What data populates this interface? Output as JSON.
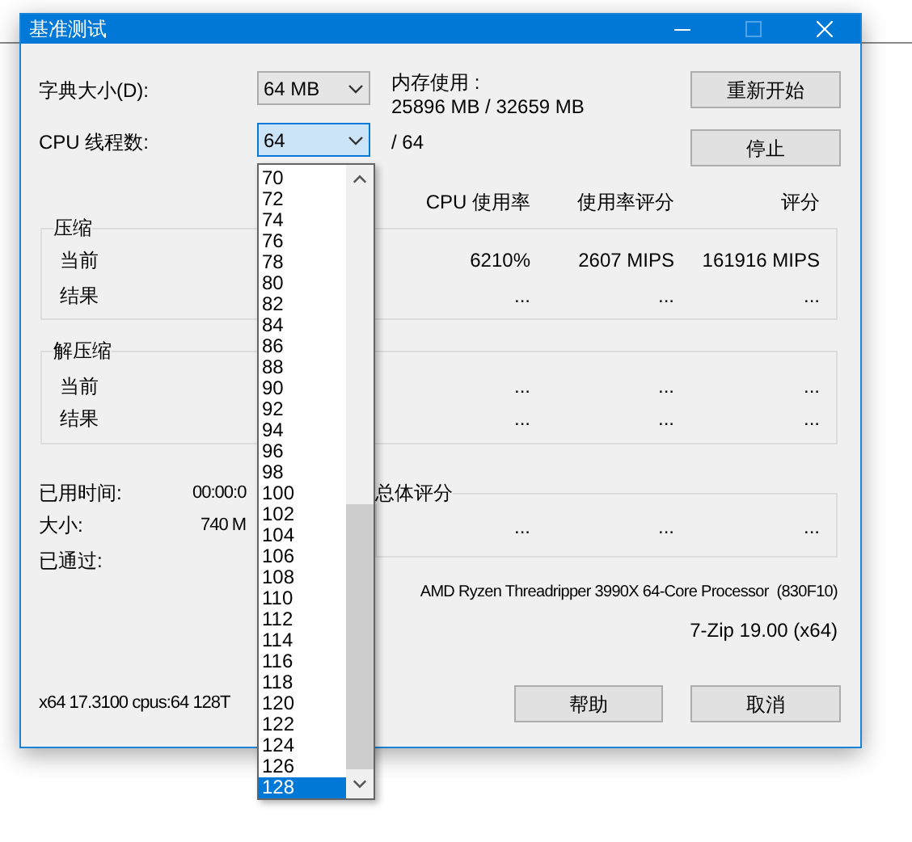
{
  "window": {
    "title": "基准测试"
  },
  "dictionary": {
    "label": "字典大小(D):",
    "value": "64 MB"
  },
  "memory": {
    "label": "内存使用 :",
    "value": "25896 MB / 32659 MB"
  },
  "threads": {
    "label": "CPU 线程数:",
    "value": "64",
    "max": "/ 64",
    "options": [
      {
        "label": "70",
        "selected": false
      },
      {
        "label": "72",
        "selected": false
      },
      {
        "label": "74",
        "selected": false
      },
      {
        "label": "76",
        "selected": false
      },
      {
        "label": "78",
        "selected": false
      },
      {
        "label": "80",
        "selected": false
      },
      {
        "label": "82",
        "selected": false
      },
      {
        "label": "84",
        "selected": false
      },
      {
        "label": "86",
        "selected": false
      },
      {
        "label": "88",
        "selected": false
      },
      {
        "label": "90",
        "selected": false
      },
      {
        "label": "92",
        "selected": false
      },
      {
        "label": "94",
        "selected": false
      },
      {
        "label": "96",
        "selected": false
      },
      {
        "label": "98",
        "selected": false
      },
      {
        "label": "100",
        "selected": false
      },
      {
        "label": "102",
        "selected": false
      },
      {
        "label": "104",
        "selected": false
      },
      {
        "label": "106",
        "selected": false
      },
      {
        "label": "108",
        "selected": false
      },
      {
        "label": "110",
        "selected": false
      },
      {
        "label": "112",
        "selected": false
      },
      {
        "label": "114",
        "selected": false
      },
      {
        "label": "116",
        "selected": false
      },
      {
        "label": "118",
        "selected": false
      },
      {
        "label": "120",
        "selected": false
      },
      {
        "label": "122",
        "selected": false
      },
      {
        "label": "124",
        "selected": false
      },
      {
        "label": "126",
        "selected": false
      },
      {
        "label": "128",
        "selected": true
      }
    ]
  },
  "buttons_top": [
    "重新开始",
    "停止"
  ],
  "columns": [
    "CPU 使用率",
    "使用率评分",
    "评分"
  ],
  "groups": [
    {
      "title": "压缩",
      "rows": [
        {
          "label": "当前",
          "cells": [
            "6210%",
            "2607 MIPS",
            "161916 MIPS"
          ]
        },
        {
          "label": "结果",
          "cells": [
            "...",
            "...",
            "..."
          ]
        }
      ]
    },
    {
      "title": "解压缩",
      "rows": [
        {
          "label": "当前",
          "cells": [
            "...",
            "...",
            "..."
          ]
        },
        {
          "label": "结果",
          "cells": [
            "...",
            "...",
            "..."
          ]
        }
      ]
    }
  ],
  "stats": [
    {
      "label": "已用时间:",
      "value": "00:00:0"
    },
    {
      "label": "大小:",
      "value": "740 M"
    },
    {
      "label": "已通过:"
    }
  ],
  "total": {
    "title": "总体评分",
    "cells": [
      "...",
      "...",
      "..."
    ]
  },
  "cpu": "AMD Ryzen Threadripper 3990X 64-Core Processor  (830F10)",
  "version": "7-Zip 19.00 (x64)",
  "info": "x64 17.3100 cpus:64 128T",
  "buttons_bottom": [
    "帮助",
    "取消"
  ]
}
